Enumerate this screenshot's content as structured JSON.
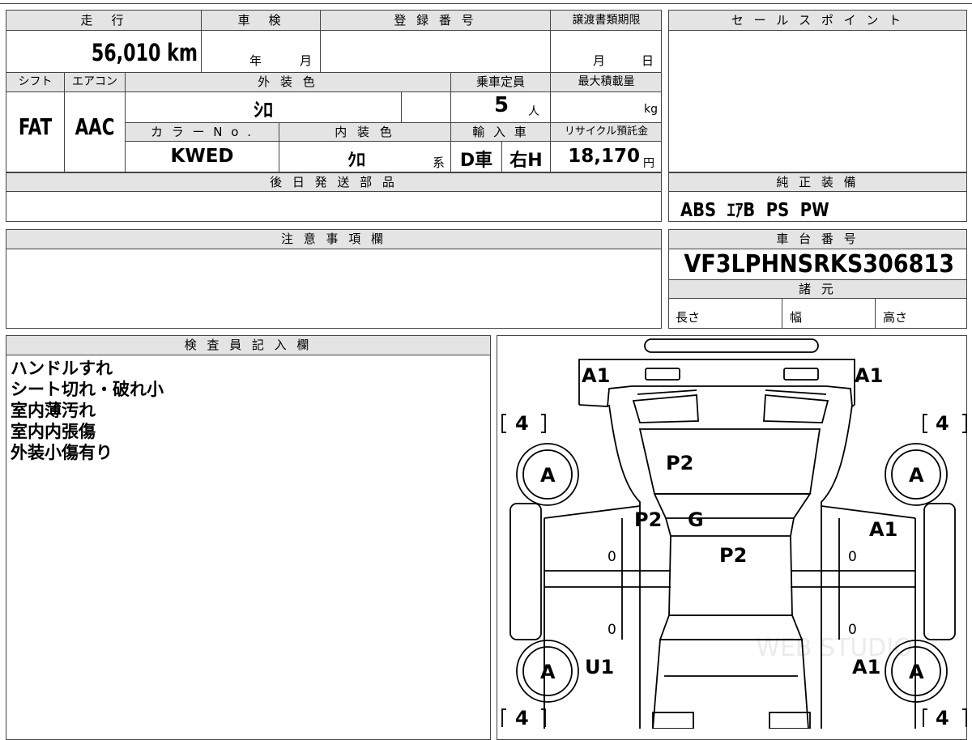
{
  "vehicle": {
    "mileage_label": "走　行",
    "mileage_value": "56,010 km",
    "inspection_label": "車　検",
    "inspection_year": "年",
    "inspection_month": "月",
    "registration_label": "登 録 番 号",
    "transfer_label": "譲渡書類期限",
    "transfer_month": "月",
    "transfer_day": "日",
    "shift_label": "シフト",
    "shift_value": "FAT",
    "ac_label": "エアコン",
    "ac_value": "AAC",
    "exterior_color_label": "外 装 色",
    "exterior_color_value": "ｼﾛ",
    "capacity_label": "乗車定員",
    "capacity_value": "5",
    "capacity_unit": "人",
    "max_load_label": "最大積載量",
    "max_load_unit": "kg",
    "color_no_label": "カ ラ ー N o .",
    "color_no_value": "KWED",
    "interior_color_label": "内 装 色",
    "interior_color_value": "ｸﾛ",
    "interior_suffix": "系",
    "import_label": "輸 入 車",
    "import_value": "D車",
    "handle_value": "右H",
    "recycle_label": "リサイクル預託金",
    "recycle_value": "18,170",
    "recycle_unit": "円"
  },
  "sections": {
    "sales_point_label": "セ ー ル ス ポ イ ン ト",
    "later_parts_label": "後 日 発 送 部 品",
    "genuine_equipment_label": "純 正 装 備",
    "genuine_equipment_value": "ABS  ｴｱB  PS  PW",
    "notes_label": "注 意 事 項 欄",
    "chassis_label": "車 台 番 号",
    "chassis_value": "VF3LPHNSRKS306813",
    "specs_label": "諸 元",
    "length_label": "長さ",
    "width_label": "幅",
    "height_label": "高さ",
    "inspector_label": "検 査 員 記 入 欄"
  },
  "inspector_notes": [
    "ハンドルすれ",
    "シート切れ・破れ小",
    "室内薄汚れ",
    "室内内張傷",
    "外装小傷有り"
  ],
  "diagram": {
    "marks": {
      "front_left": "A1",
      "front_right": "A1",
      "tire_front_left": "A",
      "tire_front_right": "A",
      "tire_rear_left": "A",
      "tire_rear_right": "A",
      "tread_front_left": "4",
      "tread_front_right": "4",
      "tread_rear_left": "4",
      "tread_rear_right": "4",
      "hood": "P2",
      "cowl_left": "P2",
      "windshield": "G",
      "roof": "P2",
      "front_door_right": "A1",
      "rear_left": "U1",
      "rear_right": "A1",
      "door_l1": "0",
      "door_l2": "0",
      "door_r1": "0",
      "door_r2": "0"
    },
    "watermark": "WEB STUDIO"
  }
}
